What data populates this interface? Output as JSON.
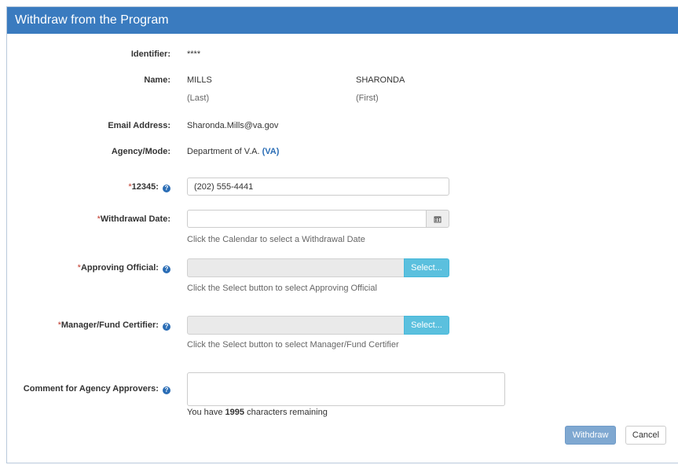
{
  "title": "Withdraw from the Program",
  "identifier": {
    "label": "Identifier:",
    "value": "****"
  },
  "name": {
    "label": "Name:",
    "last": "MILLS",
    "first": "SHARONDA",
    "last_caption": "(Last)",
    "first_caption": "(First)"
  },
  "email": {
    "label": "Email Address:",
    "value": "Sharonda.Mills@va.gov"
  },
  "agency": {
    "label": "Agency/Mode:",
    "value": "Department of V.A.",
    "code": "(VA)"
  },
  "phone": {
    "required_mark": "*",
    "label": "12345:",
    "value": "(202) 555-4441"
  },
  "withdrawal_date": {
    "required_mark": "*",
    "label": "Withdrawal Date:",
    "value": "",
    "hint": "Click the Calendar to select a Withdrawal Date"
  },
  "approving_official": {
    "required_mark": "*",
    "label": "Approving Official:",
    "button": "Select...",
    "hint": "Click the Select button to select Approving Official"
  },
  "manager": {
    "required_mark": "*",
    "label": "Manager/Fund Certifier:",
    "button": "Select...",
    "hint": "Click the Select button to select Manager/Fund Certifier"
  },
  "comment": {
    "label": "Comment for Agency Approvers:",
    "value": "",
    "counter_prefix": "You have",
    "counter_value": "1995",
    "counter_suffix": "characters remaining"
  },
  "actions": {
    "withdraw": "Withdraw",
    "cancel": "Cancel"
  },
  "icons": {
    "help": "question-circle-icon",
    "calendar": "calendar-icon"
  },
  "colors": {
    "header": "#3a7bbf",
    "select_button": "#5bc0de",
    "withdraw_button": "#7fa8d1",
    "link": "#2a6db5"
  }
}
